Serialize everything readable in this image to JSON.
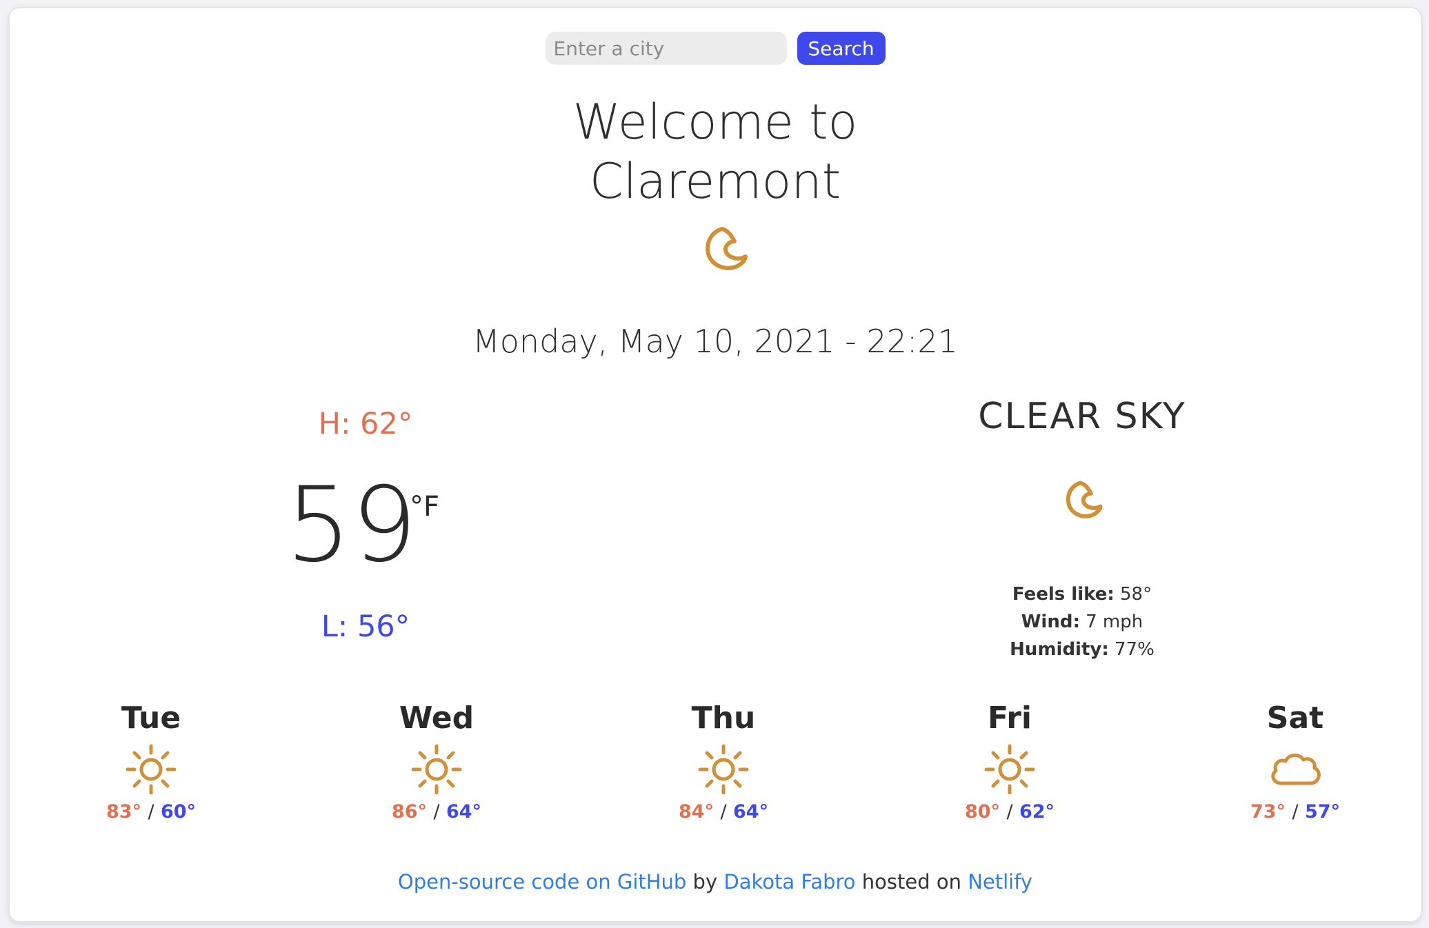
{
  "search": {
    "placeholder": "Enter a city",
    "value": "",
    "button_label": "Search"
  },
  "welcome": {
    "line1": "Welcome to",
    "line2": "Claremont"
  },
  "current": {
    "icon": "moon-icon",
    "datetime": "Monday, May 10, 2021 - 22:21",
    "high": "H: 62°",
    "temperature": "59",
    "unit": "°F",
    "low": "L: 56°",
    "description": "CLEAR SKY",
    "details": {
      "feels_like_label": "Feels like:",
      "feels_like_value": "58°",
      "wind_label": "Wind:",
      "wind_value": "7 mph",
      "humidity_label": "Humidity:",
      "humidity_value": "77%"
    }
  },
  "forecast": [
    {
      "day": "Tue",
      "icon": "sun-icon",
      "high": "83°",
      "low": "60°"
    },
    {
      "day": "Wed",
      "icon": "sun-icon",
      "high": "86°",
      "low": "64°"
    },
    {
      "day": "Thu",
      "icon": "sun-icon",
      "high": "84°",
      "low": "64°"
    },
    {
      "day": "Fri",
      "icon": "sun-icon",
      "high": "80°",
      "low": "62°"
    },
    {
      "day": "Sat",
      "icon": "cloud-icon",
      "high": "73°",
      "low": "57°"
    }
  ],
  "forecast_separator": "/",
  "footer": {
    "link1": "Open-source code on GitHub",
    "text1": " by ",
    "link2": "Dakota Fabro",
    "text2": " hosted on ",
    "link3": "Netlify"
  },
  "colors": {
    "accent": "#3f48eb",
    "high": "#e2704f",
    "low": "#3f48eb",
    "icon": "#d09038",
    "link": "#2f7fe0"
  }
}
